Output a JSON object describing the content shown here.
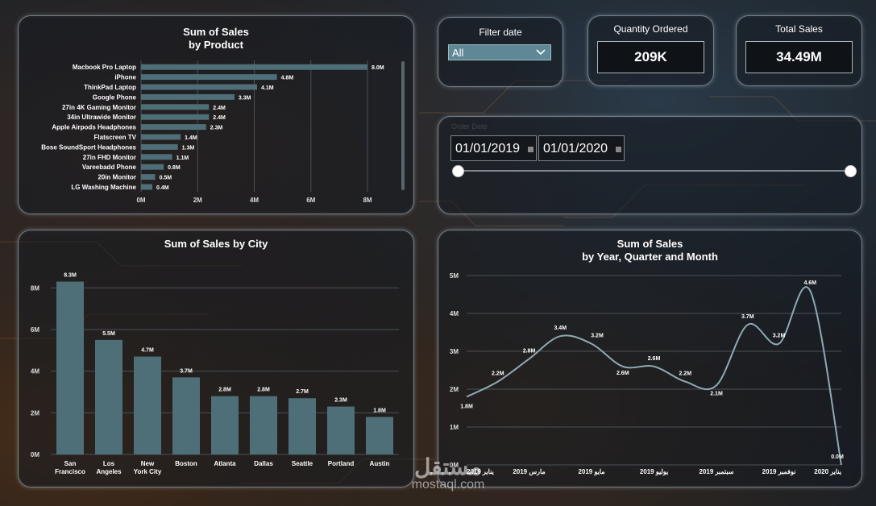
{
  "product_card": {
    "title_line1": "Sum of Sales",
    "title_line2": "by Product"
  },
  "filter_card": {
    "label": "Filter date",
    "selected": "All"
  },
  "quantity_card": {
    "label": "Quantity Ordered",
    "value": "209K"
  },
  "total_card": {
    "label": "Total Sales",
    "value": "34.49M"
  },
  "date_slicer": {
    "label": "Order Date",
    "start": "01/01/2019",
    "end": "01/01/2020",
    "range_fraction": [
      0,
      1
    ]
  },
  "city_card": {
    "title": "Sum of Sales by City"
  },
  "time_card": {
    "title_line1": "Sum of Sales",
    "title_line2": "by Year, Quarter and Month"
  },
  "watermark": {
    "arabic": "مستقل",
    "latin": "mostaql.com"
  },
  "colors": {
    "bar": "#4e6e78",
    "line": "#8fa9b4",
    "grid": "#4a5157"
  },
  "chart_data": [
    {
      "type": "bar",
      "orientation": "horizontal",
      "title": "Sum of Sales by Product",
      "categories": [
        "Macbook Pro Laptop",
        "iPhone",
        "ThinkPad Laptop",
        "Google Phone",
        "27in 4K Gaming Monitor",
        "34in Ultrawide Monitor",
        "Apple Airpods Headphones",
        "Flatscreen TV",
        "Bose SoundSport Headphones",
        "27in FHD Monitor",
        "Vareebadd Phone",
        "20in Monitor",
        "LG Washing Machine"
      ],
      "values": [
        8.0,
        4.8,
        4.1,
        3.3,
        2.4,
        2.4,
        2.3,
        1.4,
        1.3,
        1.1,
        0.8,
        0.5,
        0.4
      ],
      "data_labels": [
        "8.0M",
        "4.8M",
        "4.1M",
        "3.3M",
        "2.4M",
        "2.4M",
        "2.3M",
        "1.4M",
        "1.3M",
        "1.1M",
        "0.8M",
        "0.5M",
        "0.4M"
      ],
      "xlim": [
        0,
        8
      ],
      "xticks": [
        0,
        2,
        4,
        6,
        8
      ],
      "xtick_labels": [
        "0M",
        "2M",
        "4M",
        "6M",
        "8M"
      ],
      "grid": true
    },
    {
      "type": "bar",
      "title": "Sum of Sales by City",
      "categories": [
        "San Francisco",
        "Los Angeles",
        "New York City",
        "Boston",
        "Atlanta",
        "Dallas",
        "Seattle",
        "Portland",
        "Austin"
      ],
      "category_lines": [
        [
          "San",
          "Francisco"
        ],
        [
          "Los",
          "Angeles"
        ],
        [
          "New",
          "York City"
        ],
        [
          "Boston"
        ],
        [
          "Atlanta"
        ],
        [
          "Dallas"
        ],
        [
          "Seattle"
        ],
        [
          "Portland"
        ],
        [
          "Austin"
        ]
      ],
      "values": [
        8.3,
        5.5,
        4.7,
        3.7,
        2.8,
        2.8,
        2.7,
        2.3,
        1.8
      ],
      "data_labels": [
        "8.3M",
        "5.5M",
        "4.7M",
        "3.7M",
        "2.8M",
        "2.8M",
        "2.7M",
        "2.3M",
        "1.8M"
      ],
      "ylim": [
        0,
        8.9
      ],
      "yticks": [
        0,
        2,
        4,
        6,
        8
      ],
      "ytick_labels": [
        "0M",
        "2M",
        "4M",
        "6M",
        "8M"
      ],
      "grid": true
    },
    {
      "type": "line",
      "title": "Sum of Sales by Year, Quarter and Month",
      "x": [
        0,
        1,
        2,
        3,
        4,
        5,
        6,
        7,
        8,
        9,
        10,
        11,
        12
      ],
      "values": [
        1.8,
        2.2,
        2.8,
        3.4,
        3.2,
        2.6,
        2.6,
        2.2,
        2.1,
        3.7,
        3.2,
        4.6,
        0.0
      ],
      "data_labels": [
        "1.8M",
        "2.2M",
        "2.8M",
        "3.4M",
        "3.2M",
        "2.6M",
        "2.6M",
        "2.2M",
        "2.1M",
        "3.7M",
        "3.2M",
        "4.6M",
        "0.0M"
      ],
      "xtick_positions": [
        0,
        2,
        4,
        6,
        8,
        10,
        12
      ],
      "xtick_labels": [
        "يناير 2019",
        "مارس 2019",
        "مايو 2019",
        "يوليو 2019",
        "سبتمبر 2019",
        "نوفمبر 2019",
        "يناير 2020"
      ],
      "ylim": [
        0,
        5
      ],
      "yticks": [
        0,
        1,
        2,
        3,
        4,
        5
      ],
      "ytick_labels": [
        "0M",
        "1M",
        "2M",
        "3M",
        "4M",
        "5M"
      ],
      "grid": true
    }
  ]
}
